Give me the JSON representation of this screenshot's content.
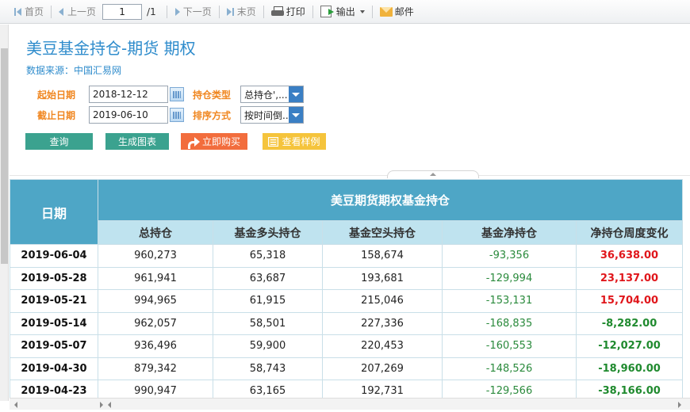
{
  "toolbar": {
    "first": "首页",
    "prev": "上一页",
    "page_value": "1",
    "page_total": "/1",
    "next": "下一页",
    "last": "末页",
    "print": "打印",
    "export": "输出",
    "mail": "邮件"
  },
  "header": {
    "title": "美豆基金持仓-期货 期权",
    "source": "数据来源：中国汇易网"
  },
  "filters": {
    "start_label": "起始日期",
    "start_value": "2018-12-12",
    "end_label": "截止日期",
    "end_value": "2019-06-10",
    "type_label": "持仓类型",
    "type_value": "总持仓',...",
    "sort_label": "排序方式",
    "sort_value": "按时间倒..."
  },
  "actions": {
    "query": "查询",
    "chart": "生成图表",
    "buy": "立即购买",
    "sample": "查看样例"
  },
  "table": {
    "date_header": "日期",
    "group_header": "美豆期货期权基金持仓",
    "columns": [
      "总持仓",
      "基金多头持仓",
      "基金空头持仓",
      "基金净持仓",
      "净持仓周度变化"
    ],
    "rows": [
      {
        "date": "2019-06-04",
        "total": "960,273",
        "long": "65,318",
        "short": "158,674",
        "net": "-93,356",
        "change": "36,638.00"
      },
      {
        "date": "2019-05-28",
        "total": "961,941",
        "long": "63,687",
        "short": "193,681",
        "net": "-129,994",
        "change": "23,137.00"
      },
      {
        "date": "2019-05-21",
        "total": "994,965",
        "long": "61,915",
        "short": "215,046",
        "net": "-153,131",
        "change": "15,704.00"
      },
      {
        "date": "2019-05-14",
        "total": "962,057",
        "long": "58,501",
        "short": "227,336",
        "net": "-168,835",
        "change": "-8,282.00"
      },
      {
        "date": "2019-05-07",
        "total": "936,496",
        "long": "59,900",
        "short": "220,453",
        "net": "-160,553",
        "change": "-12,027.00"
      },
      {
        "date": "2019-04-30",
        "total": "879,342",
        "long": "58,743",
        "short": "207,269",
        "net": "-148,526",
        "change": "-18,960.00"
      },
      {
        "date": "2019-04-23",
        "total": "990,947",
        "long": "63,165",
        "short": "192,731",
        "net": "-129,566",
        "change": "-38,166.00"
      }
    ]
  },
  "colors": {
    "title": "#2f8ccc",
    "label": "#f0861f",
    "header_bg": "#4ea6c6",
    "subheader_bg": "#bfe3ef",
    "positive": "#e0161b",
    "negative": "#1f8a2e"
  }
}
